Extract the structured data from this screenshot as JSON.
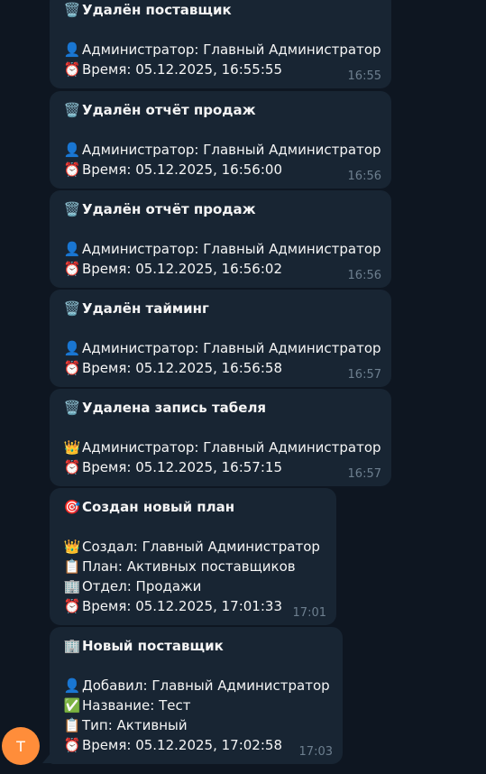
{
  "messages": [
    {
      "title": "Удалён поставщик",
      "title_icon": "🗑️",
      "lines": [
        {
          "icon": "👤",
          "icon_name": "person-icon",
          "text": "Администратор: Главный Администратор"
        },
        {
          "icon": "⏰",
          "icon_name": "alarm-clock-icon",
          "text": "Время: 05.12.2025, 16:55:55"
        }
      ],
      "time": "16:55"
    },
    {
      "title": "Удалён отчёт продаж",
      "title_icon": "🗑️",
      "lines": [
        {
          "icon": "👤",
          "icon_name": "person-icon",
          "text": "Администратор: Главный Администратор"
        },
        {
          "icon": "⏰",
          "icon_name": "alarm-clock-icon",
          "text": "Время: 05.12.2025, 16:56:00"
        }
      ],
      "time": "16:56"
    },
    {
      "title": "Удалён отчёт продаж",
      "title_icon": "🗑️",
      "lines": [
        {
          "icon": "👤",
          "icon_name": "person-icon",
          "text": "Администратор: Главный Администратор"
        },
        {
          "icon": "⏰",
          "icon_name": "alarm-clock-icon",
          "text": "Время: 05.12.2025, 16:56:02"
        }
      ],
      "time": "16:56"
    },
    {
      "title": "Удалён тайминг",
      "title_icon": "🗑️",
      "lines": [
        {
          "icon": "👤",
          "icon_name": "person-icon",
          "text": "Администратор: Главный Администратор"
        },
        {
          "icon": "⏰",
          "icon_name": "alarm-clock-icon",
          "text": "Время: 05.12.2025, 16:56:58"
        }
      ],
      "time": "16:57"
    },
    {
      "title": "Удалена запись табеля",
      "title_icon": "🗑️",
      "lines": [
        {
          "icon": "👑",
          "icon_name": "crown-icon",
          "text": "Администратор: Главный Администратор"
        },
        {
          "icon": "⏰",
          "icon_name": "alarm-clock-icon",
          "text": "Время: 05.12.2025, 16:57:15"
        }
      ],
      "time": "16:57"
    },
    {
      "title": "Создан новый план",
      "title_icon": "🎯",
      "lines": [
        {
          "icon": "👑",
          "icon_name": "crown-icon",
          "text": "Создал: Главный Администратор"
        },
        {
          "icon": "📋",
          "icon_name": "clipboard-icon",
          "text": "План: Активных поставщиков"
        },
        {
          "icon": "🏢",
          "icon_name": "office-building-icon",
          "text": "Отдел: Продажи"
        },
        {
          "icon": "⏰",
          "icon_name": "alarm-clock-icon",
          "text": "Время: 05.12.2025, 17:01:33"
        }
      ],
      "time": "17:01"
    },
    {
      "title": "Новый поставщик",
      "title_icon": "🏢",
      "lines": [
        {
          "icon": "👤",
          "icon_name": "person-icon",
          "text": "Добавил: Главный Администратор"
        },
        {
          "icon": "✅",
          "icon_name": "check-mark-icon",
          "text": "Название: Тест"
        },
        {
          "icon": "📋",
          "icon_name": "clipboard-icon",
          "text": "Тип: Активный"
        },
        {
          "icon": "⏰",
          "icon_name": "alarm-clock-icon",
          "text": "Время: 05.12.2025, 17:02:58"
        }
      ],
      "time": "17:03"
    }
  ],
  "sender": {
    "avatar_letter": "T",
    "avatar_color": "#ff8d3a"
  },
  "colors": {
    "background": "#0e1621",
    "bubble": "#182533",
    "text": "#f5f5f5",
    "time": "#6d7f8f"
  }
}
